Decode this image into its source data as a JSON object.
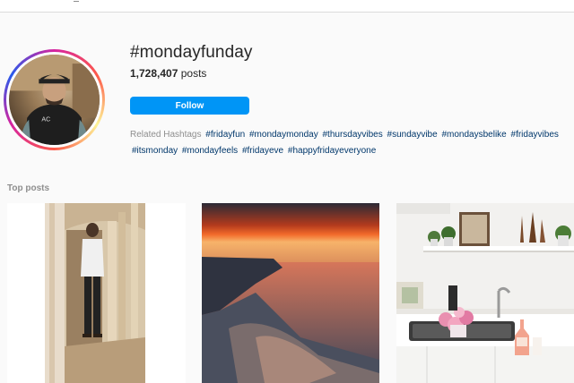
{
  "hashtag": {
    "title": "#mondayfunday",
    "post_count": "1,728,407",
    "posts_label": "posts"
  },
  "follow_button": {
    "label": "Follow"
  },
  "related": {
    "label": "Related Hashtags",
    "tags": [
      "#fridayfun",
      "#mondaymonday",
      "#thursdayvibes",
      "#sundayvibe",
      "#mondaysbelike",
      "#fridayvibes",
      "#itsmonday",
      "#mondayfeels",
      "#fridayeve",
      "#happyfridayeveryone"
    ]
  },
  "top_posts": {
    "label": "Top posts",
    "posts": [
      {
        "icon": "photo-man-in-archway"
      },
      {
        "icon": "photo-sunset-seascape"
      },
      {
        "icon": "photo-kitchen-with-flowers"
      }
    ]
  },
  "colors": {
    "follow_blue": "#0095f6",
    "tag_link": "#00376b",
    "muted_text": "#8e8e8e",
    "background": "#fafafa"
  }
}
